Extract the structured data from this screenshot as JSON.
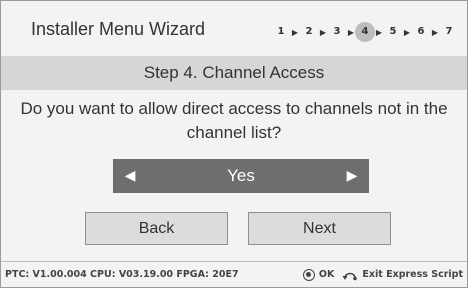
{
  "window": {
    "title": "Installer Menu Wizard"
  },
  "steps": {
    "items": [
      "1",
      "2",
      "3",
      "4",
      "5",
      "6",
      "7"
    ],
    "active_index": 3
  },
  "banner": {
    "label": "Step 4. Channel Access"
  },
  "question": {
    "text": "Do you want to allow direct access to channels not in the channel list?"
  },
  "selector": {
    "value": "Yes",
    "left_icon": "left-arrow-icon",
    "right_icon": "right-arrow-icon"
  },
  "buttons": {
    "back_label": "Back",
    "next_label": "Next"
  },
  "footer": {
    "version": "PTC: V1.00.004 CPU: V03.19.00 FPGA: 20E7",
    "ok_label": "OK",
    "exit_label": "Exit Express Script"
  },
  "colors": {
    "background": "#f3f3f3",
    "banner": "#d6d6d6",
    "selector": "#6e6e6e",
    "button": "#dcdcdc",
    "active_step": "#bdbdbd"
  }
}
